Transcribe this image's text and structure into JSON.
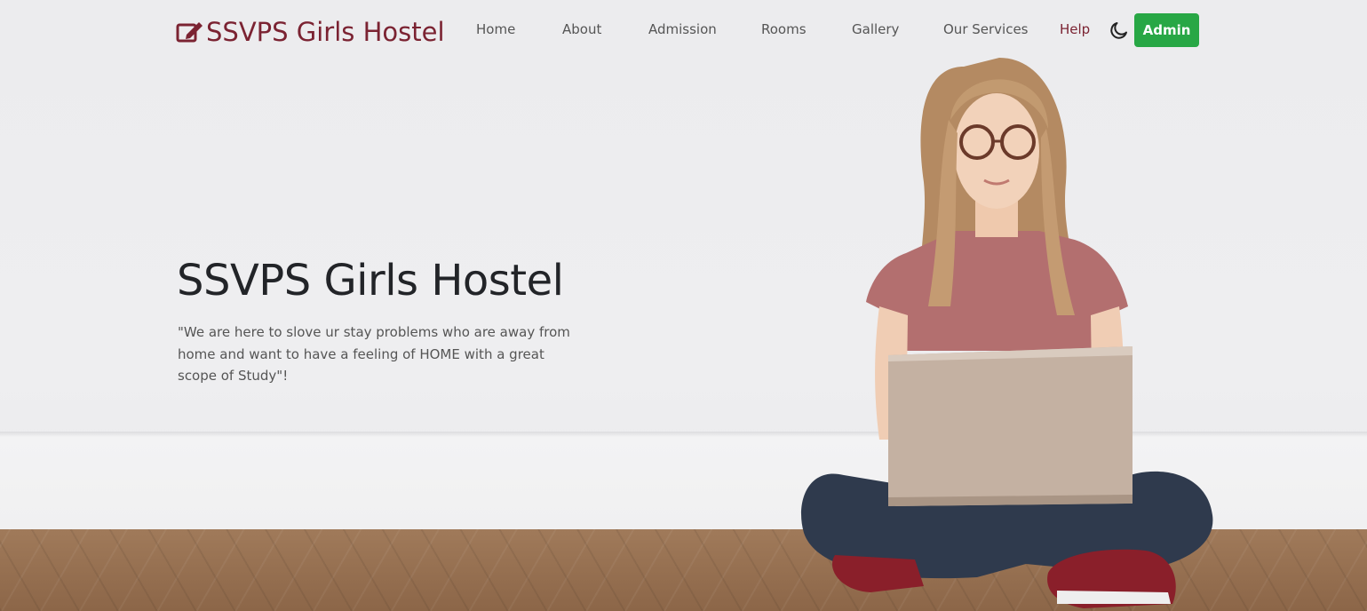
{
  "brand": {
    "title": "SSVPS Girls Hostel",
    "icon": "edit-icon",
    "color": "#7b2332"
  },
  "nav": {
    "items": [
      {
        "label": "Home"
      },
      {
        "label": "About"
      },
      {
        "label": "Admission"
      },
      {
        "label": "Rooms"
      },
      {
        "label": "Gallery"
      },
      {
        "label": "Our Services"
      },
      {
        "label": "Help"
      }
    ],
    "theme_toggle_icon": "moon-icon",
    "admin_label": "Admin",
    "admin_color": "#28a745"
  },
  "hero": {
    "title": "SSVPS Girls Hostel",
    "quote": "\"We are here to slove ur stay problems who are away from home and want to have a feeling of HOME with a great scope of Study\"!"
  }
}
